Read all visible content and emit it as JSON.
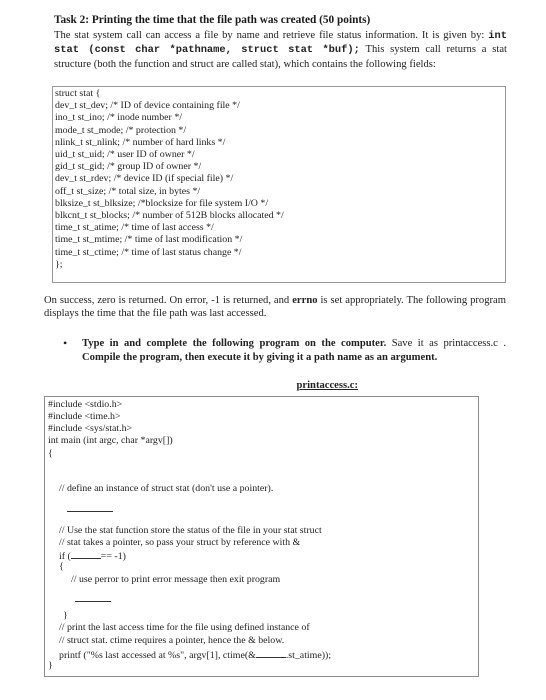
{
  "task": {
    "title": "Task 2: Printing the time that the file path was created (50 points)",
    "intro_text_1": "The stat system call can access a file by name and retrieve file status information. It is given by:",
    "signature": "int stat (const char *pathname, struct stat *buf);",
    "intro_text_2": "This system call returns a stat structure (both the function and struct are called stat), which contains the following fields:"
  },
  "struct_def": {
    "lines": [
      "struct stat {",
      "dev_t st_dev; /* ID of device containing file */",
      "ino_t st_ino; /* inode number */",
      "mode_t st_mode; /* protection */",
      "nlink_t st_nlink; /* number of hard links */",
      "uid_t st_uid; /* user ID of owner */",
      "gid_t st_gid; /* group ID of owner */",
      "dev_t st_rdev; /* device ID (if special file) */",
      "off_t st_size; /* total size, in bytes */",
      "blksize_t st_blksize; /*blocksize for file system I/O */",
      "blkcnt_t st_blocks; /* number of 512B blocks allocated */",
      "time_t st_atime; /* time of last access */",
      "time_t st_mtime; /* time of last modification */",
      "time_t st_ctime; /* time of last status change */",
      "};"
    ]
  },
  "return_info": {
    "part1": "On success, zero is returned. On error, -1 is returned, and ",
    "errno": "errno",
    "part2": " is set appropriately. The following program displays the time that the file path was last accessed."
  },
  "instruction": {
    "bold1": "Type in and complete the following program on the computer.",
    "normal": " Save it as printaccess.c . ",
    "bold2": "Compile the program, then execute it by giving it a path name as an argument."
  },
  "code": {
    "filename": "printaccess.c:",
    "lines": [
      "#include <stdio.h>",
      "#include <time.h>",
      "#include <sys/stat.h>",
      "int main (int argc, char *argv[])",
      "{",
      "// define an instance of struct stat (don't use a pointer).",
      "// Use the stat function store the status of the file in your stat struct",
      "// stat takes a pointer, so pass your struct by reference with &",
      "if (",
      "== -1)",
      "{",
      "// use perror to print error message then exit program",
      "}",
      "// print the last access time for the file using defined instance of",
      "// struct stat. ctime requires a pointer, hence the & below.",
      "printf (\"%s last accessed at %s\", argv[1], ctime(&",
      ".st_atime));",
      "}"
    ]
  }
}
